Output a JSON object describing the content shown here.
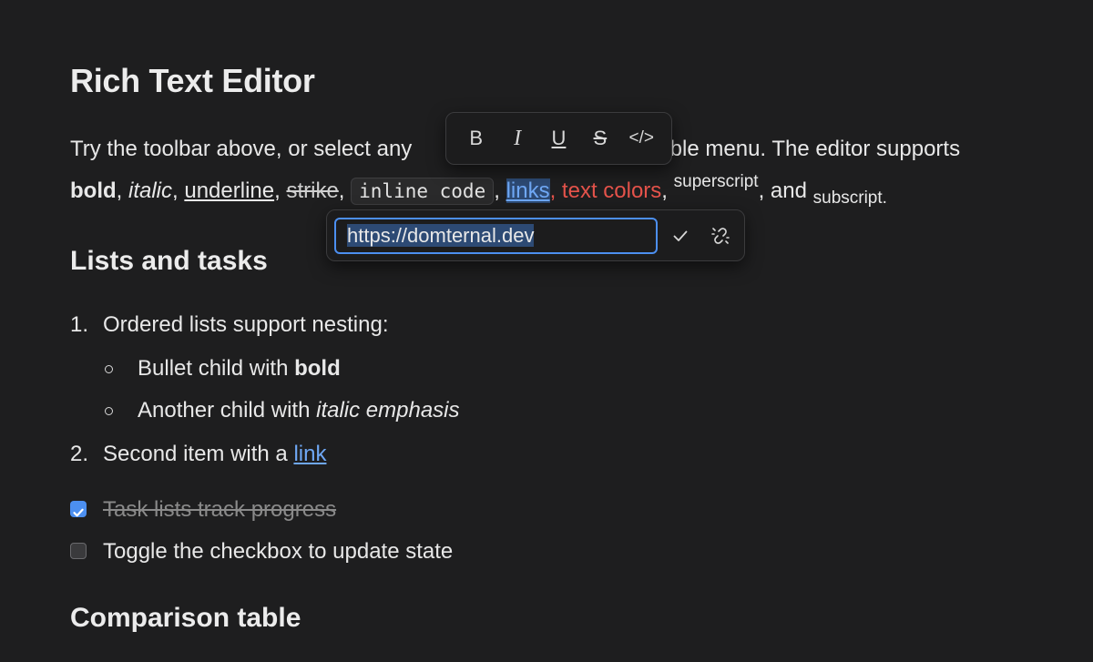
{
  "title": "Rich Text Editor",
  "para": {
    "line1_a": "Try the toolbar above, or select any",
    "line1_b": "ubble menu. The editor supports",
    "bold": "bold",
    "comma": ",",
    "italic": "italic",
    "underline": "underline",
    "strike": "strike",
    "code": "inline code",
    "link": "links",
    "colored": "text colors",
    "superscript": "superscript",
    "and": ", and",
    "subscript": "subscript",
    "period": "."
  },
  "lists_heading": "Lists and tasks",
  "ordered": [
    {
      "marker": "1.",
      "text": "Ordered lists support nesting:"
    },
    {
      "marker": "2.",
      "text_prefix": "Second item with a ",
      "link": "link"
    }
  ],
  "bullets": [
    {
      "prefix": "Bullet child with ",
      "emph": "bold"
    },
    {
      "prefix": "Another child with ",
      "emph": "italic emphasis"
    }
  ],
  "tasks": [
    {
      "checked": true,
      "text": "Task lists track progress"
    },
    {
      "checked": false,
      "text": "Toggle the checkbox to update state"
    }
  ],
  "table_heading": "Comparison table",
  "bubble_toolbar": {
    "bold_label": "B",
    "italic_label": "I",
    "underline_label": "U",
    "strike_label": "S",
    "code_label": "</>"
  },
  "link_popover": {
    "url": "https://domternal.dev"
  },
  "colors": {
    "accent": "#4c8ff0",
    "link": "#6fa8f5",
    "red": "#e5534b",
    "background": "#1e1e1f"
  }
}
